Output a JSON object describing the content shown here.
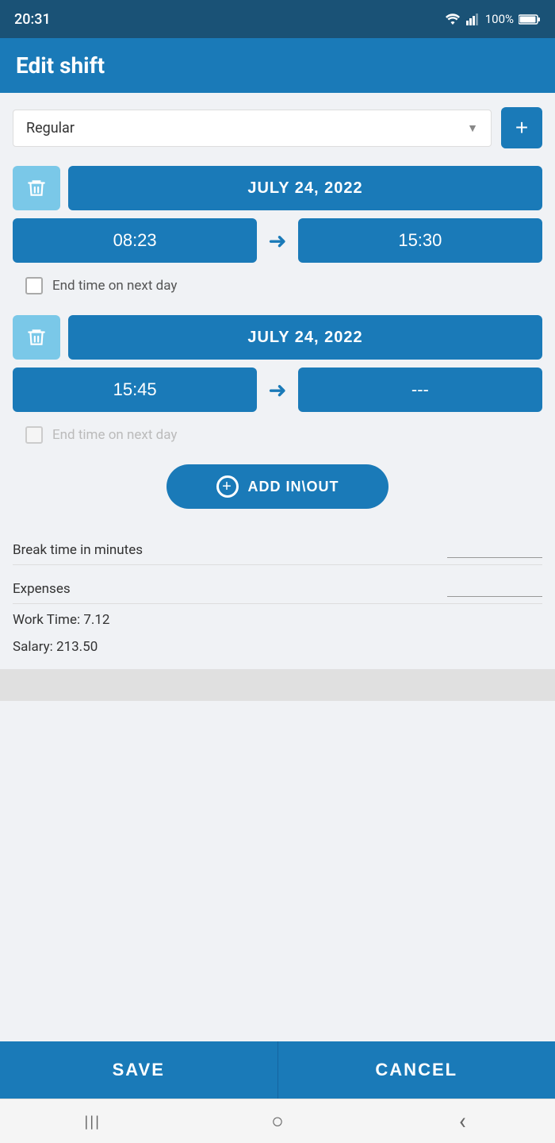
{
  "statusBar": {
    "time": "20:31",
    "battery": "100%"
  },
  "header": {
    "title": "Edit shift"
  },
  "shiftType": {
    "selected": "Regular",
    "addLabel": "+"
  },
  "entry1": {
    "date": "JULY 24, 2022",
    "startTime": "08:23",
    "endTime": "15:30",
    "nextDayLabel": "End time on next day",
    "nextDayDisabled": false
  },
  "entry2": {
    "date": "JULY 24, 2022",
    "startTime": "15:45",
    "endTime": "---",
    "nextDayLabel": "End time on next day",
    "nextDayDisabled": true
  },
  "addInOut": {
    "label": "ADD IN\\OUT"
  },
  "fields": {
    "breakLabel": "Break time in minutes",
    "expensesLabel": "Expenses"
  },
  "summary": {
    "workTime": "Work Time: 7.12",
    "salary": "Salary: 213.50"
  },
  "buttons": {
    "save": "SAVE",
    "cancel": "CANCEL"
  },
  "nav": {
    "menu": "|||",
    "home": "○",
    "back": "‹"
  }
}
